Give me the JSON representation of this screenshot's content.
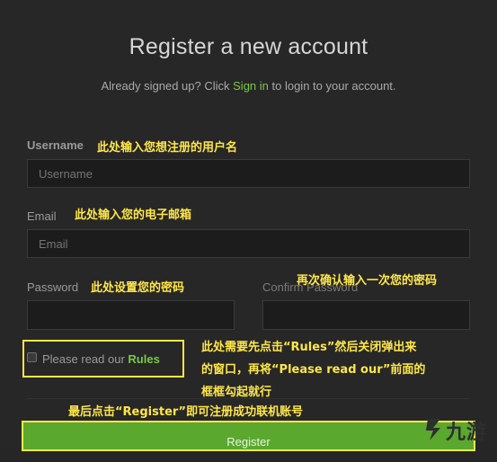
{
  "header": {
    "title": "Register a new account",
    "subtitle_prefix": "Already signed up? Click ",
    "signin_link": "Sign in",
    "subtitle_suffix": " to login to your account."
  },
  "form": {
    "username": {
      "label": "Username",
      "placeholder": "Username"
    },
    "email": {
      "label": "Email",
      "placeholder": "Email"
    },
    "password": {
      "label": "Password",
      "placeholder": ""
    },
    "confirm_password": {
      "label": "Confirm Password",
      "placeholder": ""
    },
    "rules_checkbox": {
      "prefix": "Please read our ",
      "link": "Rules",
      "checked": false
    },
    "register_button": "Register"
  },
  "annotations": {
    "username_note": "此处输入您想注册的用户名",
    "email_note": "此处输入您的电子邮箱",
    "password_note": "此处设置您的密码",
    "confirm_note": "再次确认输入一次您的密码",
    "rules_note_line1": "此处需要先点击“Rules”然后关闭弹出来",
    "rules_note_line2": "的窗口，再将“Please read our”前面的",
    "rules_note_line3": "框框勾起就行",
    "register_note": "最后点击“Register”即可注册成功联机账号"
  },
  "watermark": {
    "text": "九游",
    "icon": "jiuyou-logo-icon"
  },
  "colors": {
    "accent_green": "#7ac943",
    "button_green": "#5aa82e",
    "annotation_yellow": "#ffe74a",
    "background": "#272727"
  }
}
